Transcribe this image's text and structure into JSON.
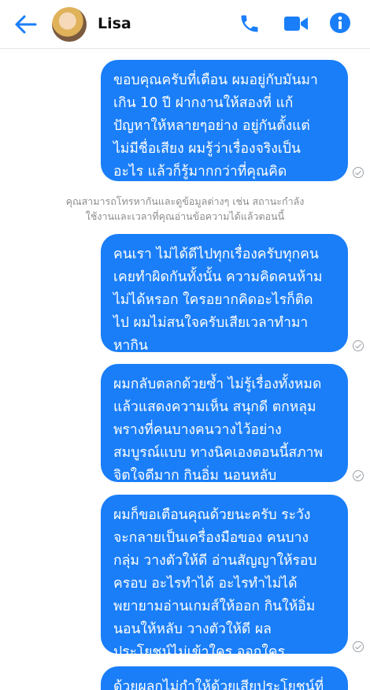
{
  "header": {
    "contact_name": "Lisa",
    "icons": [
      "back-arrow-icon",
      "phone-icon",
      "video-camera-icon",
      "info-icon"
    ],
    "accent_color": "#1a7ef8"
  },
  "messages": [
    {
      "text": "ขอบคุณครับที่เตือน ผมอยู่กับมันมา\nเกิน 10 ปี ฝากงานให้สองที่ แก้\nปัญหาให้หลายๆอย่าง อยู่กันตั้งแต่\nไม่มีชื่อเสียง ผมรู้ว่าเรื่องจริงเป็น\nอะไร แล้วก็รู้มากกว่าที่คุณคิด"
    },
    {
      "text": "คนเรา ไม่ได้ดีไปทุกเรื่องครับทุกคน\nเคยทำผิดกันทั้งนั้น ความคิดคนห้าม\nไม่ได้หรอก ใครอยากคิดอะไรก็ติด\nไป ผมไม่สนใจครับเสียเวลาทำมา\nหากิน"
    },
    {
      "text": "ผมกลับตลกด้วยซ้ำ ไม่รู้เรื่องทั้งหมด\nแล้วแสดงความเห็น สนุกดี ตกหลุม\nพรางที่คนบางคนวางไว้อย่าง\nสมบูรณ์แบบ ทางนิคเองตอนนี้สภาพ\nจิตใจดีมาก กินอิ่ม นอนหลับ"
    },
    {
      "text": "ผมก็ขอเตือนคุณด้วยนะครับ ระวัง\nจะกลายเป็นเครื่องมือของ คนบาง\nกลุ่ม วางตัวให้ดี  อ่านสัญญาให้รอบ\nครอบ อะไรทำได้ อะไรทำไม่ได้\nพยายามอ่านเกมส์ให้ออก กินให้อิ่ม\nนอนให้หลับ วางตัวให้ดี ผล\nประโยชน์ไม่เข้าใคร ออกใคร"
    },
    {
      "text": "ด้วยผลกไม่กำให้ด้วยเสียประโยชน์ที่"
    }
  ],
  "notice": {
    "text": "คุณสามารถโทรหากันและดูข้อมูลต่างๆ เช่น สถานะกำลัง\nใช้งานและเวลาที่คุณอ่านข้อความได้แล้วตอนนี้"
  }
}
